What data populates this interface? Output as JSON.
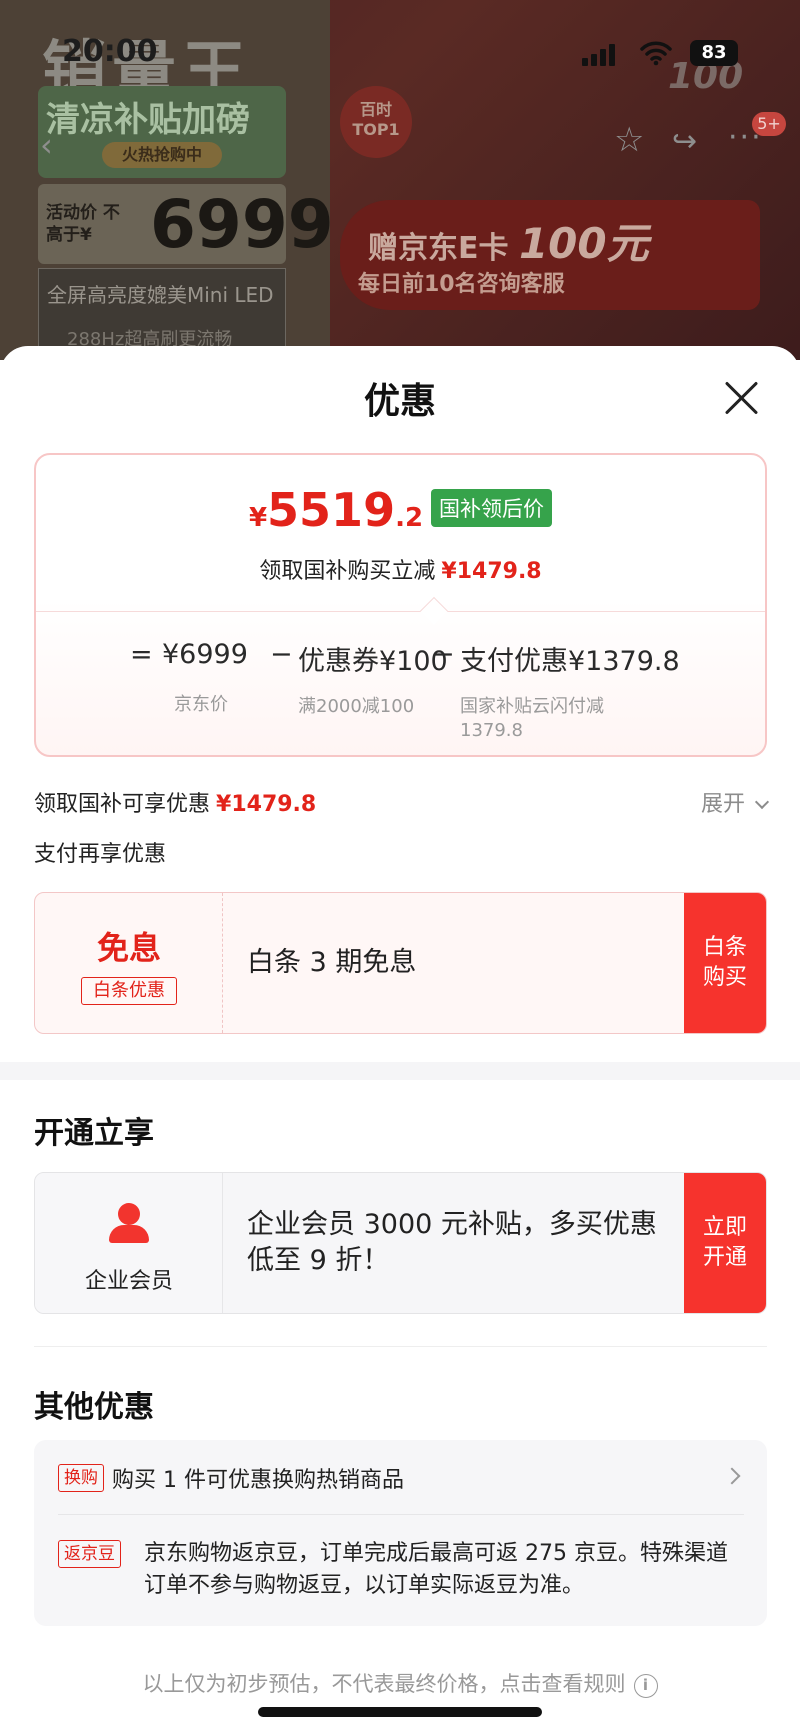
{
  "background": {
    "brand_title": "销量王",
    "promo_green": "清凉补贴加磅",
    "promo_hot": "火热抢购中",
    "price_label": "活动价 不高于¥",
    "price_value": "6999",
    "feature_1": "全屏高亮度媲美Mini LED",
    "feature_2": "288Hz超高刷更流畅",
    "badge": "百时 TOP1",
    "banner_line1_a": "赠京东E卡",
    "banner_line1_b": "100元",
    "banner_line2": "每日前10名咨询客服",
    "corner_100": "100"
  },
  "status_bar": {
    "time": "20:00",
    "battery": "83"
  },
  "nav": {
    "back_icon": "chevron-left-icon",
    "favorite_icon": "star-icon",
    "share_icon": "share-icon",
    "more_icon": "more-icon",
    "message_badge": "5+"
  },
  "sheet": {
    "title": "优惠",
    "close_icon": "close-icon"
  },
  "price_card": {
    "currency": "¥",
    "price_int": "5519",
    "price_dec": ".2",
    "price_tag": "国补领后价",
    "subtitle": "领取国补购买立减",
    "subtitle_amount": "¥1479.8",
    "formula": {
      "equals": "=",
      "jd_price": "¥6999",
      "jd_price_label": "京东价",
      "minus1": "−",
      "coupon": "优惠券¥100",
      "coupon_label": "满2000减100",
      "minus2": "−",
      "payment": "支付优惠¥1379.8",
      "payment_label_1": "国家补贴云闪付减",
      "payment_label_2": "1379.8"
    }
  },
  "subsidy_row": {
    "label": "领取国补可享优惠",
    "amount": "¥1479.8",
    "expand": "展开"
  },
  "pay_section": {
    "title": "支付再享优惠",
    "card": {
      "big": "免息",
      "tag": "白条优惠",
      "text": "白条 3 期免息",
      "button": "白条购买"
    }
  },
  "member_section": {
    "title": "开通立享",
    "card": {
      "icon": "user-icon",
      "label": "企业会员",
      "text": "企业会员 3000 元补贴，多买优惠低至 9 折！",
      "button": "立即开通"
    }
  },
  "other_section": {
    "title": "其他优惠",
    "row1_tag": "换购",
    "row1_text": "购买 1 件可优惠换购热销商品",
    "row2_tag": "返京豆",
    "row2_text": "京东购物返京豆，订单完成后最高可返 275 京豆。特殊渠道订单不参与购物返豆，以订单实际返豆为准。"
  },
  "footer": {
    "text": "以上仅为初步预估，不代表最终价格，点击查看规则",
    "info_icon": "info-icon"
  },
  "colors": {
    "accent_red": "#e2231a",
    "button_red": "#f6332d",
    "tag_green": "#36a34b"
  }
}
